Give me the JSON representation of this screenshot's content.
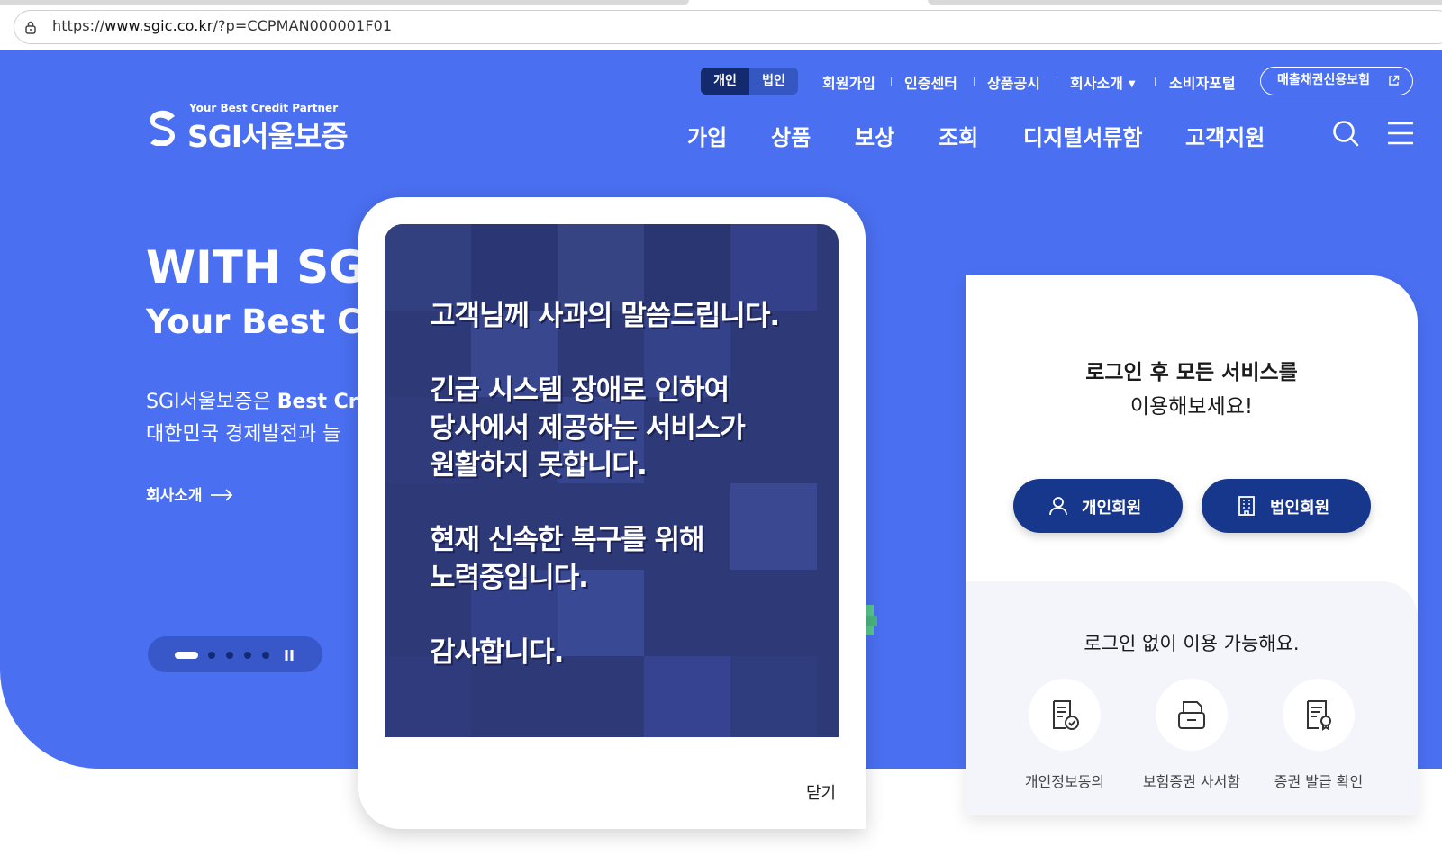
{
  "browser": {
    "url_prefix": "https://",
    "url_host": "www.sgic.co.kr",
    "url_path": "/?p=CCPMAN000001F01"
  },
  "header": {
    "scope_personal": "개인",
    "scope_corporate": "법인",
    "util_links": [
      "회원가입",
      "인증센터",
      "상품공시",
      "회사소개",
      "소비자포털"
    ],
    "sales_button": "매출채권신용보험",
    "logo_tagline": "Your Best Credit Partner",
    "logo_name": "SGI서울보증",
    "nav": [
      "가입",
      "상품",
      "보상",
      "조회",
      "디지털서류함",
      "고객지원"
    ]
  },
  "hero": {
    "title": "WITH SGI,",
    "subtitle": "Your Best Cr",
    "desc1_prefix": "SGI서울보증은 ",
    "desc1_bold": "Best Cr",
    "desc2": "대한민국 경제발전과 늘",
    "about_link": "회사소개",
    "pager_slides": 5,
    "pager_active": 1
  },
  "login": {
    "line1": "로그인 후 모든 서비스를",
    "line2": "이용해보세요!",
    "personal_btn": "개인회원",
    "corporate_btn": "법인회원",
    "quick_title": "로그인 없이 이용 가능해요.",
    "quick_items": [
      {
        "label": "개인정보동의",
        "icon": "document-check-icon"
      },
      {
        "label": "보험증권 사서함",
        "icon": "mailbox-icon"
      },
      {
        "label": "증권 발급 확인",
        "icon": "certificate-icon"
      }
    ]
  },
  "popup": {
    "notice_lines": [
      "고객님께 사과의 말씀드립니다.",
      "",
      "긴급 시스템 장애로 인하여",
      "당사에서 제공하는 서비스가",
      "원활하지 못합니다.",
      "",
      "현재 신속한 복구를 위해",
      "노력중입니다.",
      "",
      "감사합니다."
    ],
    "close_label": "닫기"
  },
  "colors": {
    "hero_bg": "#4a6ff0",
    "navy": "#17378c",
    "notice_bg": "#2e3a78"
  }
}
